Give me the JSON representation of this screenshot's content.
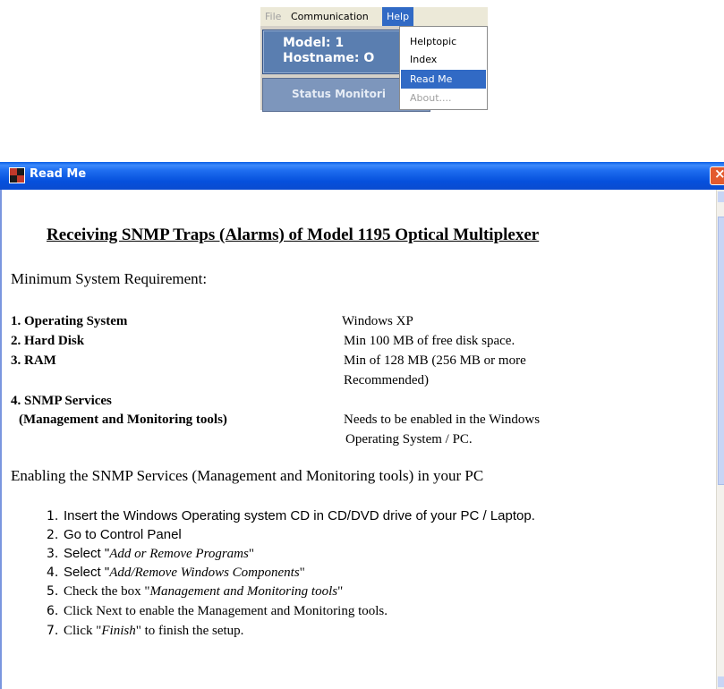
{
  "menubar": {
    "items": [
      {
        "label": "File"
      },
      {
        "label": "Communication"
      },
      {
        "label": "Help"
      }
    ]
  },
  "info_panel": {
    "model_line": "Model:      1",
    "hostname_line": "Hostname:  O",
    "status_tab": "Status Monitori"
  },
  "help_menu": {
    "items": [
      {
        "label": "Helptopic"
      },
      {
        "label": "Index"
      },
      {
        "label": "Read Me"
      },
      {
        "label": "About...."
      }
    ]
  },
  "window": {
    "title": "Read Me"
  },
  "document": {
    "title": "Receiving SNMP Traps (Alarms) of Model 1195 Optical Multiplexer",
    "min_req_heading": "Minimum System Requirement:",
    "requirements": [
      {
        "label": "1. Operating System",
        "value": [
          "Windows XP"
        ]
      },
      {
        "label": "2. Hard Disk",
        "value": [
          "Min 100 MB of free disk space."
        ]
      },
      {
        "label": "3. RAM",
        "value": [
          "Min of 128 MB (256 MB or more",
          "Recommended)"
        ]
      },
      {
        "label": "4. SNMP Services",
        "value": []
      },
      {
        "label": "(Management and Monitoring tools)",
        "value": [
          "Needs to be enabled in the Windows",
          "Operating System / PC."
        ]
      }
    ],
    "enable_heading": "Enabling the SNMP Services (Management and Monitoring tools) in your PC",
    "steps": [
      {
        "num": "1.",
        "text": "Insert the Windows Operating system CD in CD/DVD drive of your PC / Laptop."
      },
      {
        "num": "2.",
        "text": "Go to Control Panel"
      },
      {
        "num": "3.",
        "pre": "Select \"",
        "em": "Add or Remove Programs",
        "post": "\""
      },
      {
        "num": "4.",
        "pre": "Select \"",
        "em": "Add/Remove Windows Components",
        "post": "\""
      },
      {
        "num": "5.",
        "pre": "Check the box \"",
        "em": "Management and Monitoring tools",
        "post": "\""
      },
      {
        "num": "6.",
        "text": "Click Next to enable the Management and Monitoring tools."
      },
      {
        "num": "7.",
        "pre": "Click \"",
        "em": "Finish",
        "post": "\" to finish the setup."
      }
    ]
  },
  "colors": {
    "menu_highlight": "#316ac5",
    "titlebar": "#0a5fe6",
    "close_button": "#e35a2e",
    "info_panel": "#5a7eb0"
  }
}
